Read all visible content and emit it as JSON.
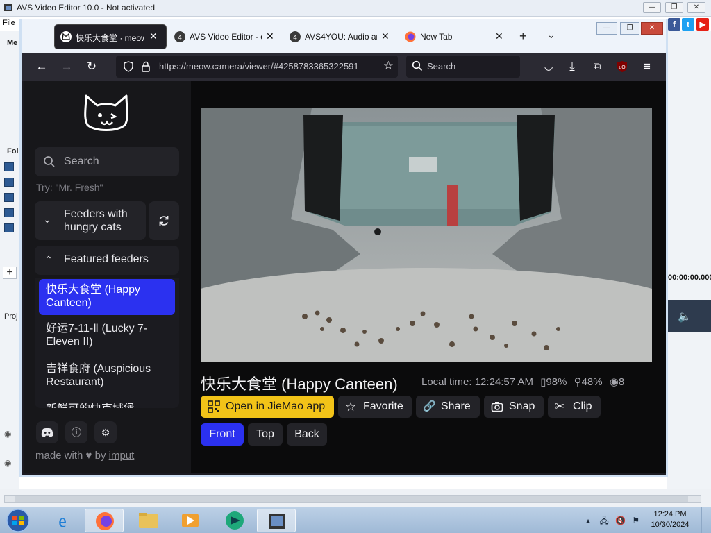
{
  "avs": {
    "title": "AVS Video Editor 10.0 - Not activated",
    "menu_file": "File",
    "left_label_1": "Me",
    "left_label_2": "Fol",
    "project_label": "Proj",
    "timecode": "00:00:00.000",
    "social": [
      {
        "icon": "facebook-icon",
        "glyph": "f",
        "color": "#3b5998"
      },
      {
        "icon": "twitter-icon",
        "glyph": "t",
        "color": "#1da1f2"
      },
      {
        "icon": "youtube-icon",
        "glyph": "▶",
        "color": "#e62117"
      }
    ]
  },
  "browser": {
    "tabs": [
      {
        "label": "快乐大食堂 · meow.",
        "icon": "cat-favicon-icon",
        "active": true
      },
      {
        "label": "AVS Video Editor - e",
        "icon": "avs4you-favicon-icon",
        "active": false
      },
      {
        "label": "AVS4YOU: Audio an",
        "icon": "avs4you-favicon-icon",
        "active": false
      },
      {
        "label": "New Tab",
        "icon": "firefox-icon",
        "active": false
      }
    ],
    "url": "https://meow.camera/viewer/#4258783365322591",
    "search_placeholder": "Search"
  },
  "sidebar": {
    "search_placeholder": "Search",
    "search_hint": "Try: \"Mr. Fresh\"",
    "hungry_section": "Feeders with hungry cats",
    "featured_section": "Featured feeders",
    "feeders": [
      {
        "label": "快乐大食堂 (Happy Canteen)",
        "selected": true
      },
      {
        "label": "好运7-11-Ⅱ (Lucky 7-Eleven II)",
        "selected": false
      },
      {
        "label": "吉祥食府 (Auspicious Restaurant)",
        "selected": false
      },
      {
        "label": "新鲜可的快克城堡",
        "selected": false
      }
    ],
    "made_with_prefix": "made with",
    "made_with_by": "by",
    "made_with_link": "imput"
  },
  "camera": {
    "title": "快乐大食堂 (Happy Canteen)",
    "local_time_label": "Local time:",
    "local_time": "12:24:57 AM",
    "battery": "98%",
    "signal": "48%",
    "viewers": "8",
    "actions": {
      "open_app": "Open in JieMao app",
      "favorite": "Favorite",
      "share": "Share",
      "snap": "Snap",
      "clip": "Clip"
    },
    "views": [
      "Front",
      "Top",
      "Back"
    ],
    "selected_view": "Front"
  },
  "taskbar": {
    "time": "12:24 PM",
    "date": "10/30/2024"
  }
}
